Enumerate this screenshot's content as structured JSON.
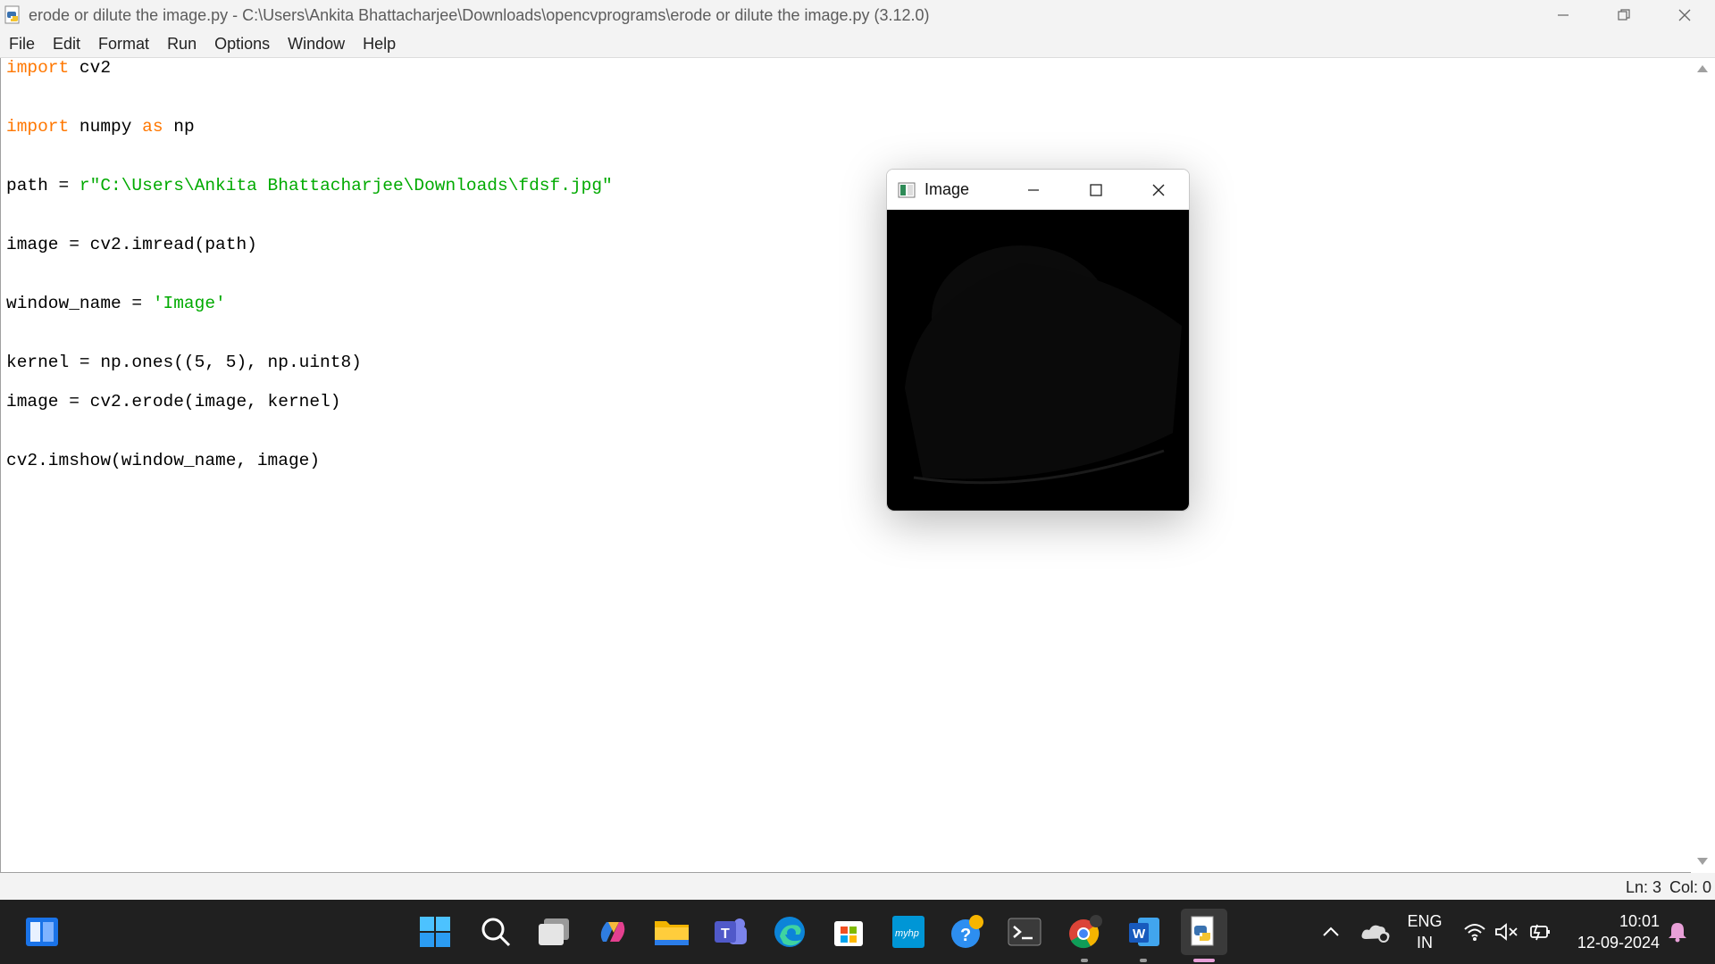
{
  "window": {
    "title": "erode or dilute the image.py - C:\\Users\\Ankita Bhattacharjee\\Downloads\\opencvprograms\\erode or dilute the image.py (3.12.0)"
  },
  "menu": [
    "File",
    "Edit",
    "Format",
    "Run",
    "Options",
    "Window",
    "Help"
  ],
  "code": {
    "l1_kw": "import",
    "l1_rest": " cv2",
    "l2_kw": "import",
    "l2_mid": " numpy ",
    "l2_kw2": "as",
    "l2_rest": " np",
    "l3_pre": "path = ",
    "l3_str": "r\"C:\\Users\\Ankita Bhattacharjee\\Downloads\\fdsf.jpg\"",
    "l4": "image = cv2.imread(path)",
    "l5_pre": "window_name = ",
    "l5_str": "'Image'",
    "l6": "kernel = np.ones((5, 5), np.uint8)",
    "l7": "image = cv2.erode(image, kernel)",
    "l8": "cv2.imshow(window_name, image)"
  },
  "status": {
    "line": "Ln: 3",
    "col": "Col: 0"
  },
  "image_window": {
    "title": "Image"
  },
  "taskbar": {
    "lang_top": "ENG",
    "lang_bottom": "IN",
    "time": "10:01",
    "date": "12-09-2024",
    "icons": [
      "widgets-icon",
      "start-icon",
      "search-icon",
      "task-view-icon",
      "copilot-icon",
      "file-explorer-icon",
      "teams-icon",
      "edge-icon",
      "store-icon",
      "myhp-icon",
      "help-icon",
      "terminal-icon",
      "chrome-icon",
      "word-icon",
      "python-idle-icon"
    ],
    "myhp_label": "myhp",
    "word_label": "W"
  },
  "colors": {
    "keyword": "#ff7700",
    "string": "#00aa00",
    "taskbar": "#202020"
  }
}
